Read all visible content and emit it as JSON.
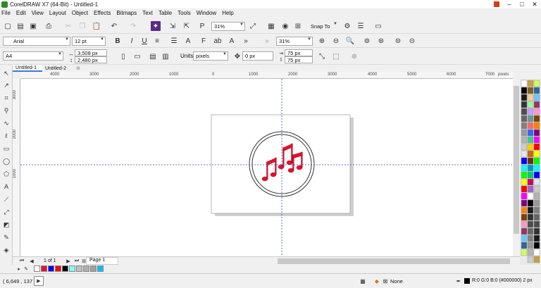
{
  "window": {
    "title": "CorelDRAW X7 (64-Bit) - Untitled-1",
    "min": "–",
    "max": "□",
    "close": "✕"
  },
  "menu": [
    "File",
    "Edit",
    "View",
    "Layout",
    "Object",
    "Effects",
    "Bitmaps",
    "Text",
    "Table",
    "Tools",
    "Window",
    "Help"
  ],
  "toolbar": {
    "zoom": "31%",
    "snap_to": "Snap To"
  },
  "property_bar": {
    "font": "Arial",
    "font_size": "12 pt",
    "page_size": "A4",
    "width": "3,508 px",
    "height": "2,480 px",
    "units_label": "Units:",
    "units": "pixels",
    "nudge": "0 px",
    "dup_x": "75 px",
    "dup_y": "75 px",
    "zoom2": "31%"
  },
  "tabs": [
    "Untitled-1",
    "Untitled-2"
  ],
  "ruler": {
    "h": [
      "4000",
      "3000",
      "2000",
      "1000",
      "0",
      "1000",
      "2000",
      "3000",
      "4000",
      "5000",
      "6000",
      "7000"
    ],
    "h_unit": "pixels",
    "v": [
      "3000",
      "2000",
      "1000"
    ]
  },
  "pagebar": {
    "page_count": "1 of 1",
    "page_label": "Page 1"
  },
  "status": {
    "coords": "( 6,649 , 137 )",
    "fill": "None",
    "outline": "R:0 G:0 B:0 (#000000)  2 px"
  },
  "palette_colors": [
    "#ffffff",
    "#000000",
    "#1a1a1a",
    "#333333",
    "#4d4d4d",
    "#666666",
    "#808080",
    "#999999",
    "#b3b3b3",
    "#cccccc",
    "#e6e6e6",
    "#0000ff",
    "#00ffff",
    "#00ff00",
    "#ffff00",
    "#ff0000",
    "#ff00ff",
    "#800080",
    "#ff8000",
    "#804000",
    "#ff99cc",
    "#993366",
    "#66ccff",
    "#336699",
    "#ccff66"
  ],
  "doc_palette": [
    "#ffffff",
    "#e8102c",
    "#0000ff",
    "#ff0000",
    "#000000",
    "#80ffff",
    "#c0c0c0",
    "#b0b0b0",
    "#a0a0a0",
    "#00bfff"
  ]
}
